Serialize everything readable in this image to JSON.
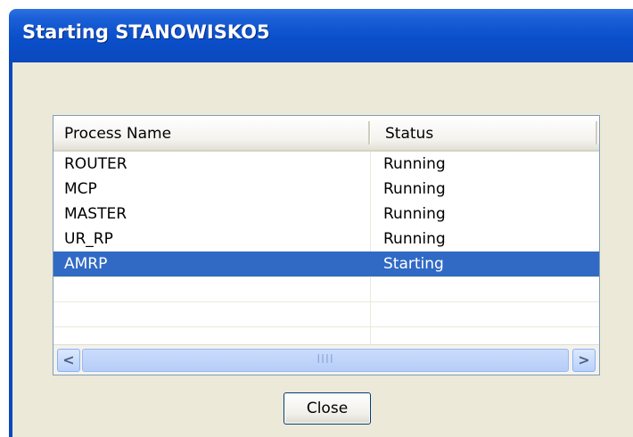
{
  "window": {
    "title": "Starting STANOWISKO5"
  },
  "list": {
    "columns": [
      "Process Name",
      "Status"
    ],
    "rows": [
      {
        "name": "ROUTER",
        "status": "Running",
        "selected": false
      },
      {
        "name": "MCP",
        "status": "Running",
        "selected": false
      },
      {
        "name": "MASTER",
        "status": "Running",
        "selected": false
      },
      {
        "name": "UR_RP",
        "status": "Running",
        "selected": false
      },
      {
        "name": "AMRP",
        "status": "Starting",
        "selected": true
      }
    ]
  },
  "scrollbar": {
    "left_glyph": "<",
    "right_glyph": ">",
    "grip_glyph": "IIII"
  },
  "buttons": {
    "close_label": "Close"
  },
  "colors": {
    "title_bar": "#0b48bd",
    "client_background": "#ece9d8",
    "selection": "#316ac5"
  }
}
